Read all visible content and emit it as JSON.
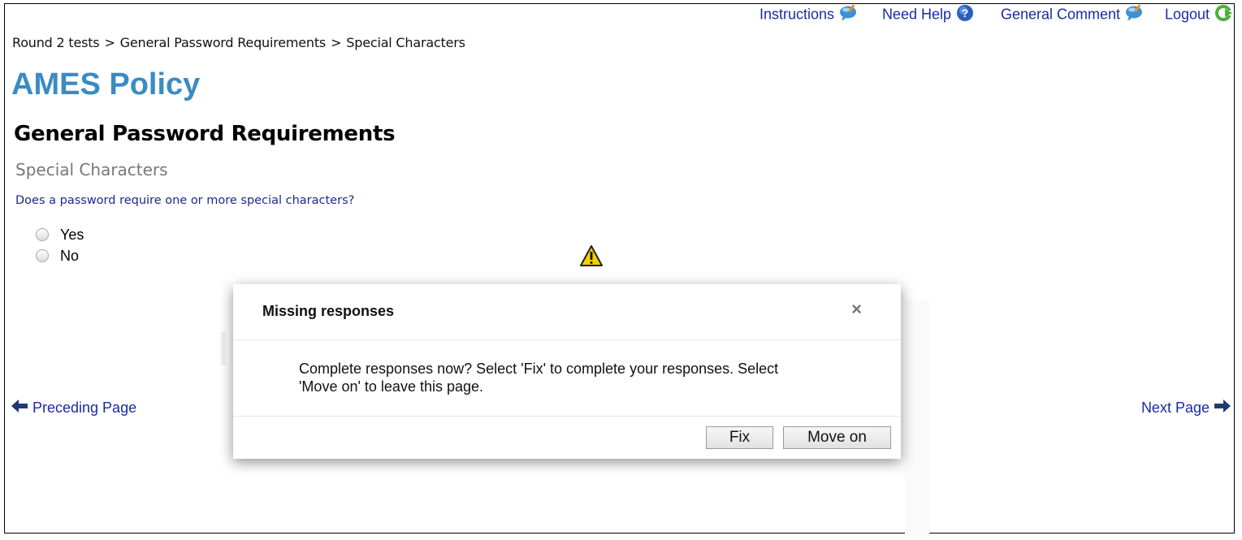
{
  "header": {
    "links": [
      {
        "label": "Instructions",
        "icon": "comment-bubble-icon"
      },
      {
        "label": "Need Help",
        "icon": "help-icon"
      },
      {
        "label": "General Comment",
        "icon": "comment-bubble-icon"
      },
      {
        "label": "Logout",
        "icon": "logout-icon"
      }
    ]
  },
  "breadcrumb": {
    "items": [
      "Round 2 tests",
      "General Password Requirements",
      "Special Characters"
    ],
    "separator": ">"
  },
  "app_title": "AMES Policy",
  "section_title": "General Password Requirements",
  "subsection_title": "Special Characters",
  "question": {
    "text": "Does a password require one or more special characters?",
    "options": [
      "Yes",
      "No"
    ],
    "selected": null
  },
  "navigation": {
    "prev_label": "Preceding Page",
    "next_label": "Next Page"
  },
  "modal": {
    "title": "Missing responses",
    "close_symbol": "×",
    "body_line1": "Complete responses now? Select 'Fix' to complete your responses. Select",
    "body_line2": "'Move on' to leave this page.",
    "fix_label": "Fix",
    "move_on_label": "Move on"
  },
  "colors": {
    "link": "#1a2aa6",
    "title": "#3a8cc1",
    "question": "#1a2a8a",
    "warning": "#f5d000"
  }
}
